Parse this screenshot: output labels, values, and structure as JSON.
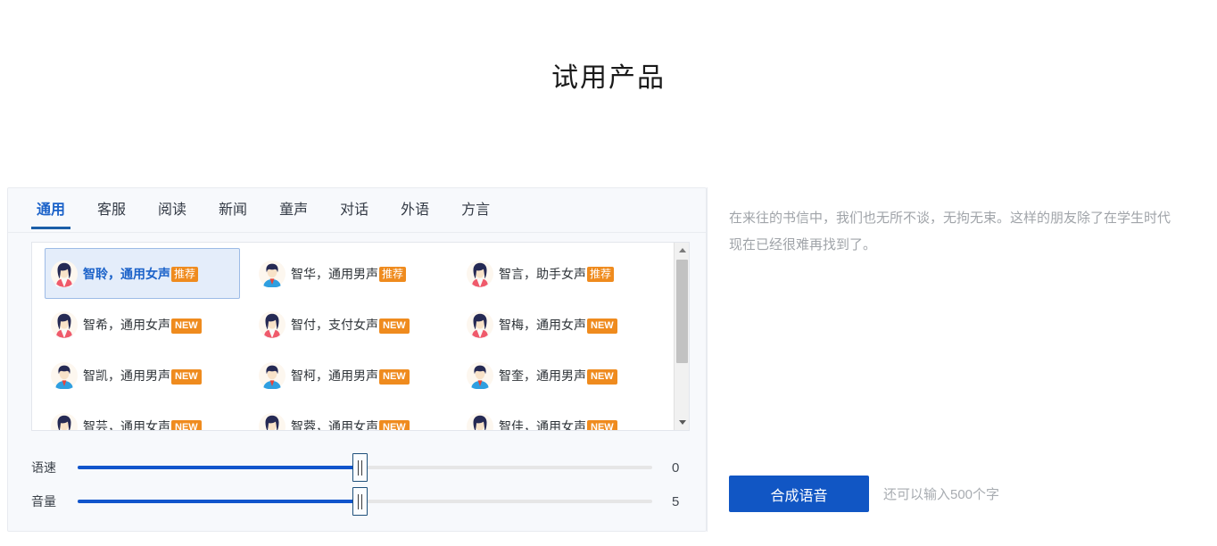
{
  "page": {
    "title": "试用产品"
  },
  "tabs": [
    {
      "label": "通用",
      "active": true
    },
    {
      "label": "客服",
      "active": false
    },
    {
      "label": "阅读",
      "active": false
    },
    {
      "label": "新闻",
      "active": false
    },
    {
      "label": "童声",
      "active": false
    },
    {
      "label": "对话",
      "active": false
    },
    {
      "label": "外语",
      "active": false
    },
    {
      "label": "方言",
      "active": false
    }
  ],
  "voice_list": {
    "rows": [
      [
        {
          "name": "智聆，通用女声",
          "badge": "推荐",
          "badge_type": "cn",
          "gender": "female",
          "selected": true
        },
        {
          "name": "智华，通用男声",
          "badge": "推荐",
          "badge_type": "cn",
          "gender": "male",
          "selected": false
        },
        {
          "name": "智言，助手女声",
          "badge": "推荐",
          "badge_type": "cn",
          "gender": "female",
          "selected": false
        }
      ],
      [
        {
          "name": "智希，通用女声",
          "badge": "NEW",
          "badge_type": "en",
          "gender": "female",
          "selected": false
        },
        {
          "name": "智付，支付女声",
          "badge": "NEW",
          "badge_type": "en",
          "gender": "female",
          "selected": false
        },
        {
          "name": "智梅，通用女声",
          "badge": "NEW",
          "badge_type": "en",
          "gender": "female",
          "selected": false
        }
      ],
      [
        {
          "name": "智凯，通用男声",
          "badge": "NEW",
          "badge_type": "en",
          "gender": "male",
          "selected": false
        },
        {
          "name": "智柯，通用男声",
          "badge": "NEW",
          "badge_type": "en",
          "gender": "male",
          "selected": false
        },
        {
          "name": "智奎，通用男声",
          "badge": "NEW",
          "badge_type": "en",
          "gender": "male",
          "selected": false
        }
      ],
      [
        {
          "name": "智芸，通用女声",
          "badge": "NEW",
          "badge_type": "en",
          "gender": "female",
          "selected": false
        },
        {
          "name": "智蓉，通用女声",
          "badge": "NEW",
          "badge_type": "en",
          "gender": "female",
          "selected": false
        },
        {
          "name": "智佳，通用女声",
          "badge": "NEW",
          "badge_type": "en",
          "gender": "female",
          "selected": false
        }
      ]
    ]
  },
  "sliders": [
    {
      "label": "语速",
      "value": "0",
      "percent": 49
    },
    {
      "label": "音量",
      "value": "5",
      "percent": 49
    }
  ],
  "editor": {
    "text": "在来往的书信中，我们也无所不谈，无拘无束。这样的朋友除了在学生时代现在已经很难再找到了。",
    "synth_label": "合成语音",
    "char_hint": "还可以输入500个字"
  },
  "colors": {
    "accent": "#1156c4",
    "badge": "#ef8b1e",
    "selected_bg": "#e4edfa",
    "panel_bg": "#f7f9fc"
  }
}
